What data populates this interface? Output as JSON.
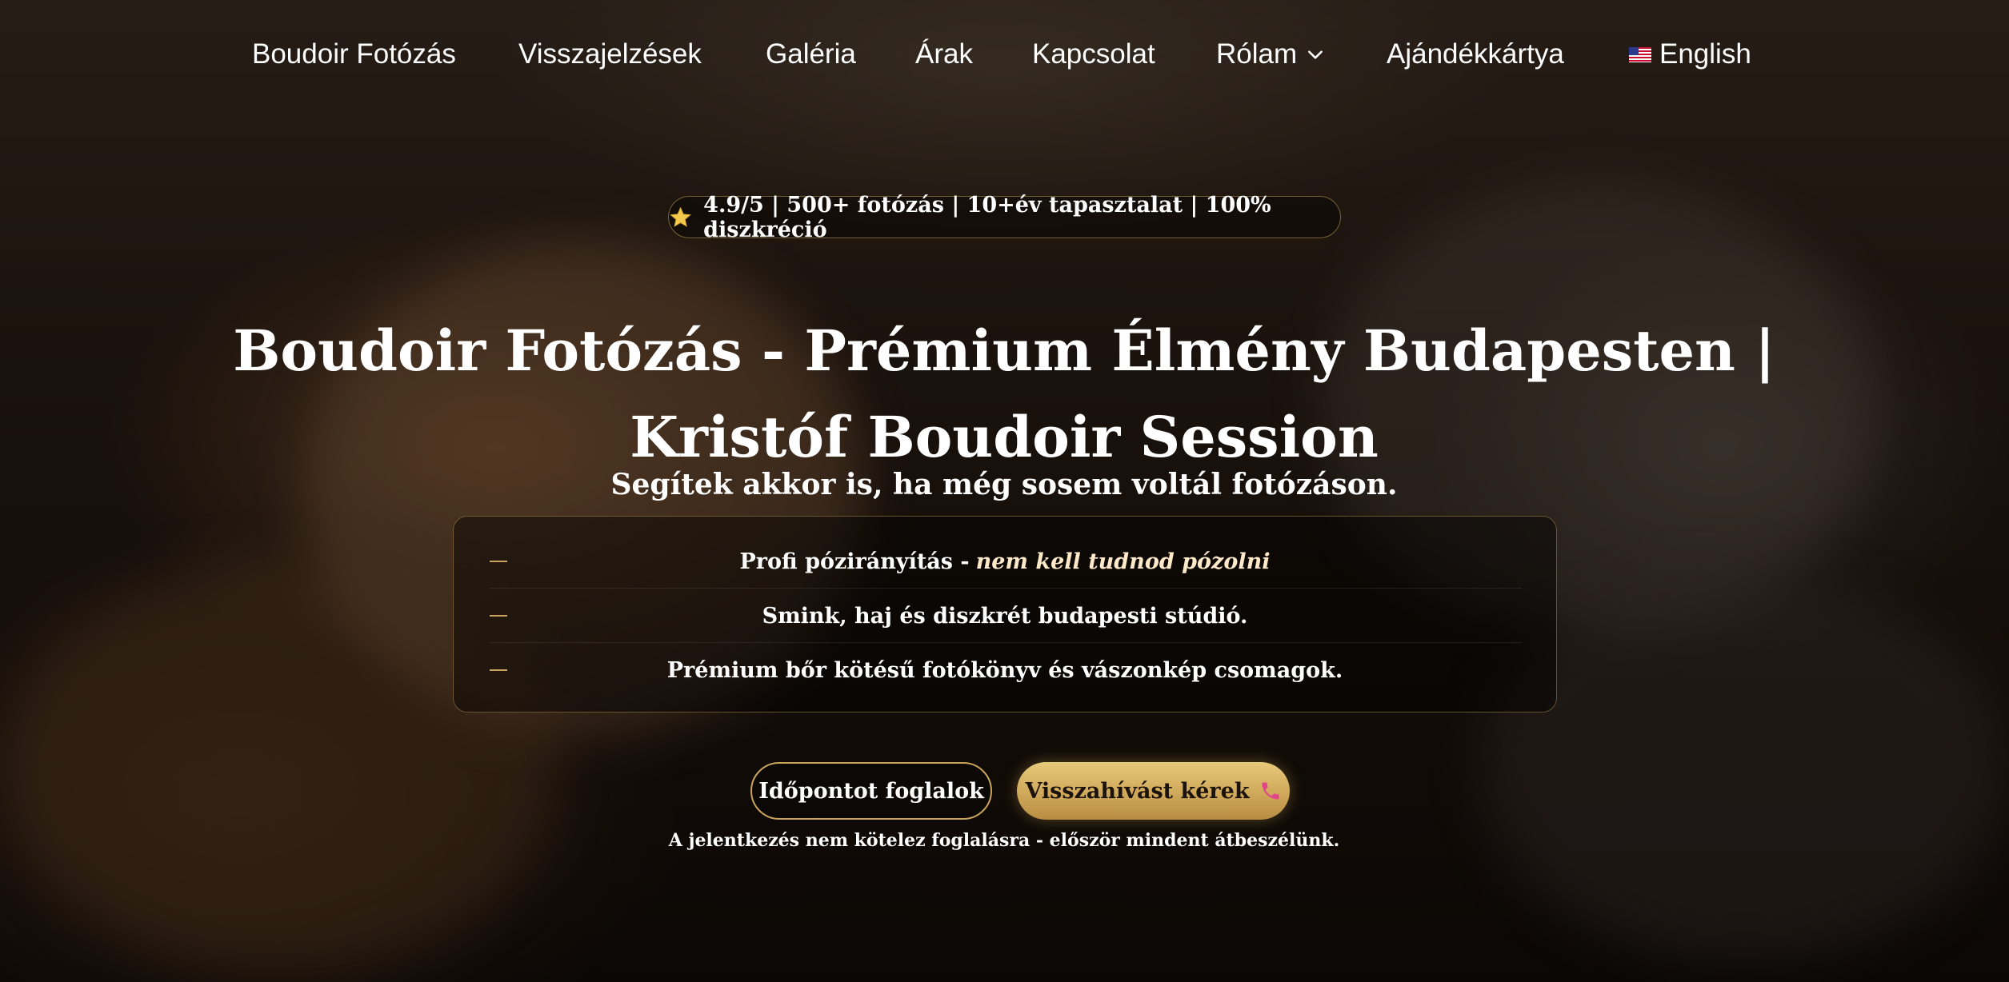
{
  "nav": {
    "items": [
      {
        "label": "Boudoir Fotózás"
      },
      {
        "label": "Visszajelzések"
      },
      {
        "label": "Galéria"
      },
      {
        "label": "Árak"
      },
      {
        "label": "Kapcsolat"
      },
      {
        "label": "Rólam"
      },
      {
        "label": "Ajándékkártya"
      },
      {
        "label": "English"
      }
    ]
  },
  "hero": {
    "rating_text": "4.9/5 | 500+ fotózás | 10+év tapasztalat | 100% diszkréció",
    "title_line1": "Boudoir Fotózás - Prémium Élmény Budapesten |",
    "title_line2": "Kristóf Boudoir Session",
    "subtitle": "Segítek akkor is, ha még sosem voltál fotózáson.",
    "features": [
      {
        "text": "Profi pózirányítás -",
        "emphasis": "nem kell tudnod pózolni"
      },
      {
        "text": "Smink, haj és diszkrét budapesti stúdió."
      },
      {
        "text": "Prémium bőr kötésű fotókönyv és vászonkép csomagok."
      }
    ],
    "book_button": "Időpontot foglalok",
    "callback_button": "Visszahívást kérek",
    "note": "A jelentkezés nem kötelez foglalásra - először mindent átbeszélünk."
  },
  "colors": {
    "accent_gold": "#c9a45a",
    "button_gold": "#d0a85a",
    "text": "#ffffff"
  },
  "icons": [
    "star-icon",
    "chevron-down-icon",
    "us-flag-icon",
    "dash-icon",
    "phone-icon"
  ]
}
